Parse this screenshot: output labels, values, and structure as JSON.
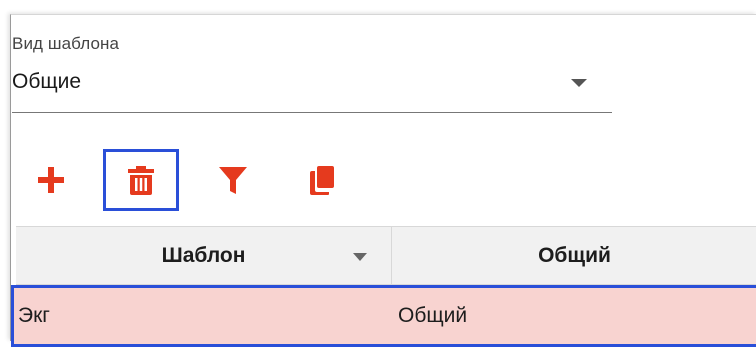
{
  "template_field": {
    "label": "Вид шаблона",
    "value": "Общие"
  },
  "toolbar": {
    "icon_color": "#e53a1e",
    "selected_border_color": "#2a4fd8",
    "icons": [
      "plus-icon",
      "trash-icon",
      "filter-icon",
      "copy-icon"
    ]
  },
  "table": {
    "columns": [
      "Шаблон",
      "Общий"
    ],
    "sort_column": "Шаблон",
    "rows": [
      {
        "name": "Экг",
        "type": "Общий",
        "selected": true
      }
    ],
    "selected_row_color": "#f8d3d0"
  }
}
